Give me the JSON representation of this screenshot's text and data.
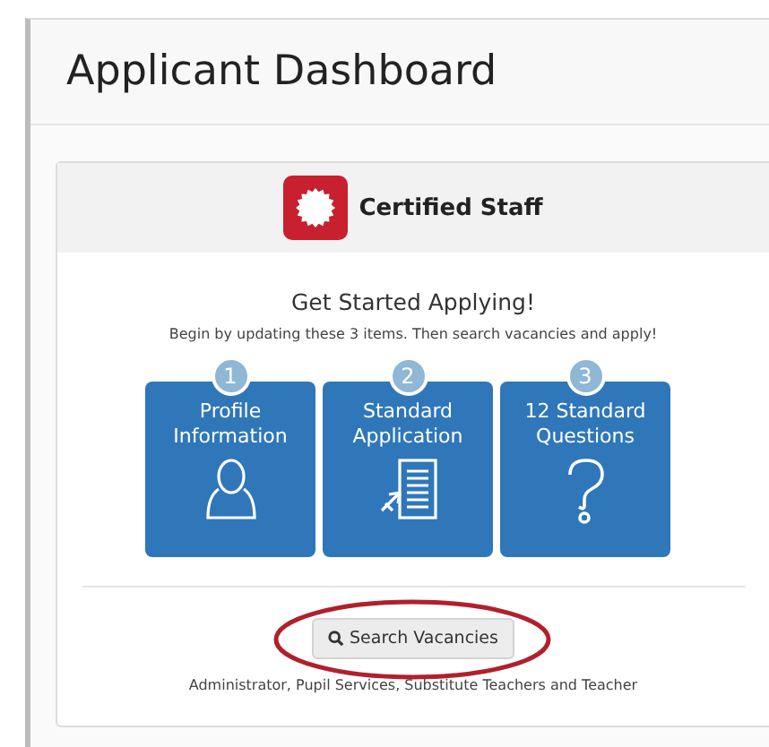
{
  "page": {
    "title": "Applicant Dashboard"
  },
  "card": {
    "header": "Certified Staff",
    "heading": "Get Started Applying!",
    "instructions": "Begin by updating these 3 items. Then search vacancies and apply!",
    "steps": [
      {
        "number": "1",
        "label": "Profile Information",
        "kind": "person"
      },
      {
        "number": "2",
        "label": "Standard Application",
        "kind": "document"
      },
      {
        "number": "3",
        "label": "12 Standard Questions",
        "kind": "question"
      }
    ],
    "search_button": {
      "label": "Search Vacancies",
      "highlighted": true
    },
    "categories": "Administrator,  Pupil Services,  Substitute Teachers and  Teacher"
  }
}
